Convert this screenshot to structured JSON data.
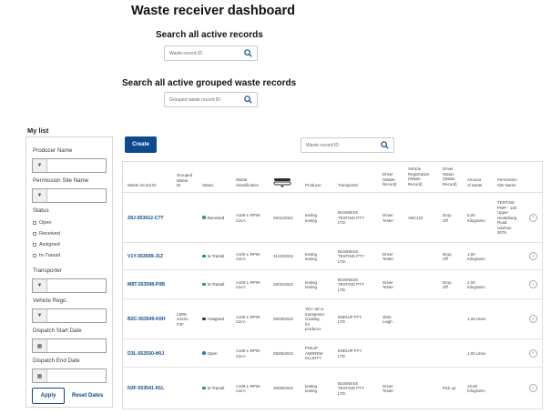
{
  "page": {
    "title": "Waste receiver dashboard",
    "colors": {
      "primary": "#0d4b8e",
      "received": "#2e9e4f",
      "in_transit": "#0e8a8a",
      "assigned": "#1d2f57",
      "open": "#1f7ab8"
    }
  },
  "search_active": {
    "title": "Search all active records",
    "placeholder": "Waste record ID",
    "icon": "search-icon"
  },
  "search_grouped": {
    "title": "Search all active grouped waste records",
    "placeholder": "Grouped waste record ID",
    "icon": "search-icon"
  },
  "my_list": {
    "title": "My list",
    "producer_name": {
      "label": "Producer Name",
      "value": ""
    },
    "permission_site_name": {
      "label": "Permission Site Name",
      "value": ""
    },
    "status": {
      "label": "Status",
      "options": [
        "Open",
        "Received",
        "Assigned",
        "In-Transit"
      ]
    },
    "transporter": {
      "label": "Transporter",
      "value": ""
    },
    "vehicle_rego": {
      "label": "Vehicle Rego.",
      "value": ""
    },
    "dispatch_start_date": {
      "label": "Dispatch Start Date",
      "value": ""
    },
    "dispatch_end_date": {
      "label": "Dispatch End Date",
      "value": ""
    },
    "apply_label": "Apply",
    "reset_label": "Reset Dates"
  },
  "toolbar": {
    "create_label": "Create",
    "search_placeholder": "Waste record ID"
  },
  "table": {
    "headers": {
      "waste_record_id": "Waste record ID",
      "grouped_waste_id": "Grouped\nWaste\nID",
      "status": "Status",
      "waste_classification": "Waste\nclassification",
      "producer": "Producer",
      "transporter": "Transporter",
      "driver_waste_record": "Driver\n(Waste\nRecord)",
      "vehicle_registration": "Vehicle\nRegistration\n(Waste\nRecord)",
      "driver_status": "Driver\nStatus\n(Waste\nRecord)",
      "amount_of_waste": "Amount\nof waste",
      "permission_site_name": "Permission\nSite Name"
    },
    "rows": [
      {
        "waste_record_id": "Z8J-553612-C7T",
        "grouped_waste_id": "",
        "status": "Received",
        "waste_classification": "A100-L-RPW-\nCat A",
        "date": "09/11/2022",
        "producer": "testing\ntesting",
        "transporter": "BUSINESS\nTESTING PTY\nLTD.",
        "driver": "Driver\nTester",
        "vehicle": "ABC123",
        "driver_status": "Drop\nOff",
        "amount": "0.00\nKilograms",
        "permission_site": "TESTING\nPWP - 140\nUpper\nHeidelberg\nRoad\nIvanhoe\n3079"
      },
      {
        "waste_record_id": "V1Y-553599-J1Z",
        "grouped_waste_id": "",
        "status": "In-Transit",
        "waste_classification": "A100-L-RPW-\nCat A",
        "date": "31/10/2022",
        "producer": "testing\ntesting",
        "transporter": "BUSINESS\nTESTING PTY\nLTD.",
        "driver": "Driver\nTester",
        "vehicle": "",
        "driver_status": "Drop\nOff",
        "amount": "1.00\nKilograms",
        "permission_site": ""
      },
      {
        "waste_record_id": "M8T-553598-P0B",
        "grouped_waste_id": "",
        "status": "In-Transit",
        "waste_classification": "A100-L-RPW-\nCat A",
        "date": "28/10/2022",
        "producer": "testing\ntesting",
        "transporter": "BUSINESS\nTESTING PTY\nLTD.",
        "driver": "Driver\nTester",
        "vehicle": "",
        "driver_status": "Drop\nOff",
        "amount": "1.00\nKilograms",
        "permission_site": ""
      },
      {
        "waste_record_id": "B2C-553549-K6H",
        "grouped_waste_id": "L5R6-\n42121-\nF4F",
        "status": "Assigned",
        "waste_classification": "A100-L-RPW-\nCat A",
        "date": "05/09/2022",
        "producer": "Yes i am a\ntransporter\ncreating\nfor\nproducer",
        "transporter": "ENDUIP PTY\nLTD",
        "driver": "Jiisle\nLeigh",
        "vehicle": "",
        "driver_status": "",
        "amount": "1.00 Litres",
        "permission_site": ""
      },
      {
        "waste_record_id": "D3L-553550-H0J",
        "grouped_waste_id": "",
        "status": "Open",
        "waste_classification": "A100-L-RPW-\nCat A",
        "date": "05/09/2022",
        "producer": "PHILIP\nANDREW\nELLIOTT",
        "transporter": "ENDUIP PTY\nLTD",
        "driver": "",
        "vehicle": "",
        "driver_status": "",
        "amount": "1.00 Litres",
        "permission_site": ""
      },
      {
        "waste_record_id": "N3F-553541-H1L",
        "grouped_waste_id": "",
        "status": "In-Transit",
        "waste_classification": "A100-L-RPW-\nCat A",
        "date": "30/08/2022",
        "producer": "testing\ntesting",
        "transporter": "BUSINESS\nTESTING PTY\nLTD.",
        "driver": "Driver\nTester",
        "vehicle": "",
        "driver_status": "Pick up",
        "amount": "10.00\nKilograms",
        "permission_site": ""
      }
    ]
  }
}
